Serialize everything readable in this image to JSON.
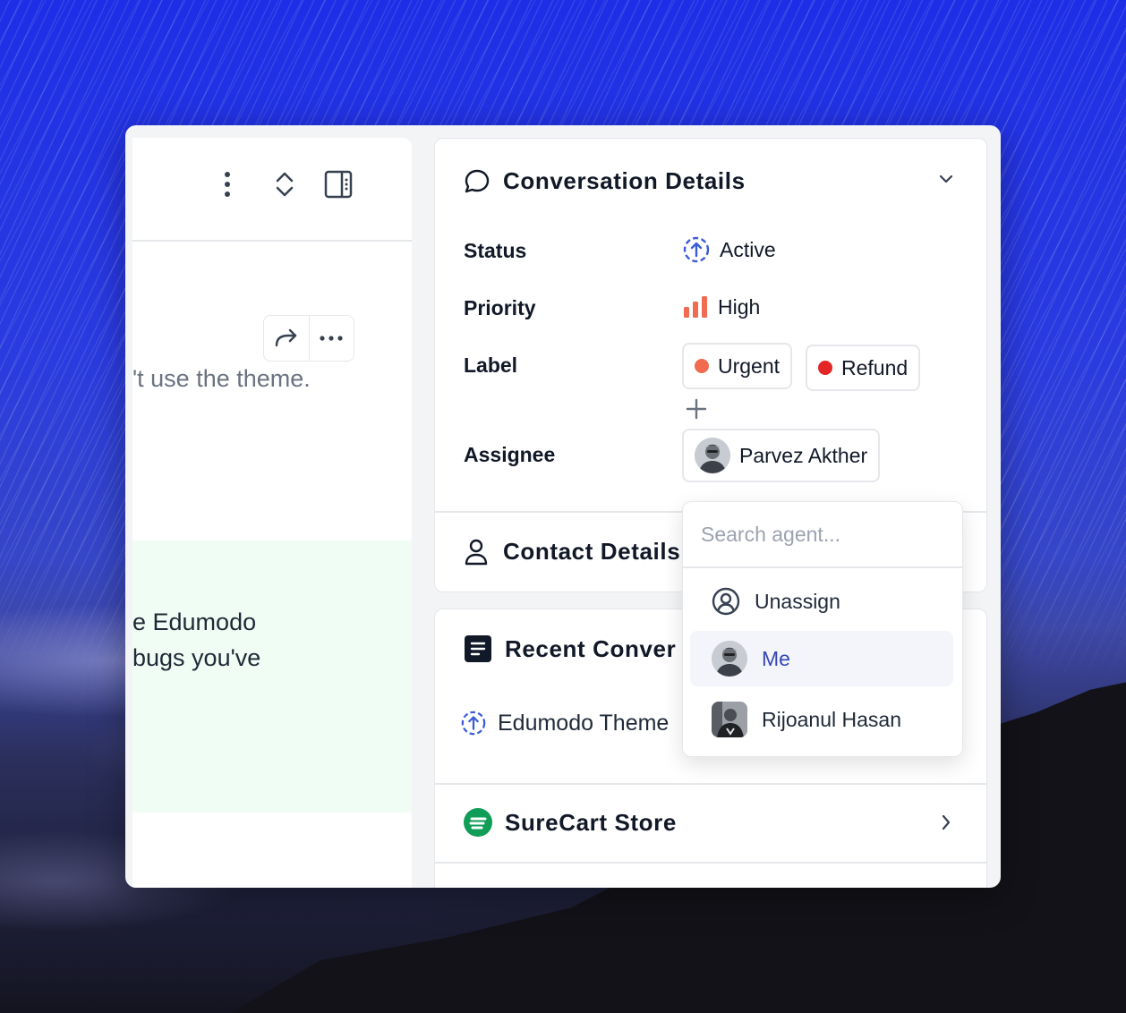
{
  "conversation": {
    "message_fragment": "'t use the theme.",
    "reply_lines": [
      "e Edumodo",
      "bugs you've"
    ]
  },
  "details": {
    "title": "Conversation Details",
    "status_label": "Status",
    "status_value": "Active",
    "priority_label": "Priority",
    "priority_value": "High",
    "label_label": "Label",
    "labels": [
      {
        "name": "Urgent",
        "color": "#f06b50"
      },
      {
        "name": "Refund",
        "color": "#e42525"
      }
    ],
    "assignee_label": "Assignee",
    "assignee_value": "Parvez Akther"
  },
  "contact": {
    "title": "Contact Details"
  },
  "recent": {
    "title": "Recent Conver",
    "item": "Edumodo Theme"
  },
  "store": {
    "title": "SureCart Store",
    "brand_color": "#0f9d58"
  },
  "agent_dropdown": {
    "search_placeholder": "Search agent...",
    "options": [
      "Unassign",
      "Me",
      "Rijoanul Hasan"
    ],
    "selected": "Me"
  },
  "colors": {
    "accent": "#3447b5",
    "active_status": "#3b5bdb",
    "priority_high": "#f06b50"
  }
}
